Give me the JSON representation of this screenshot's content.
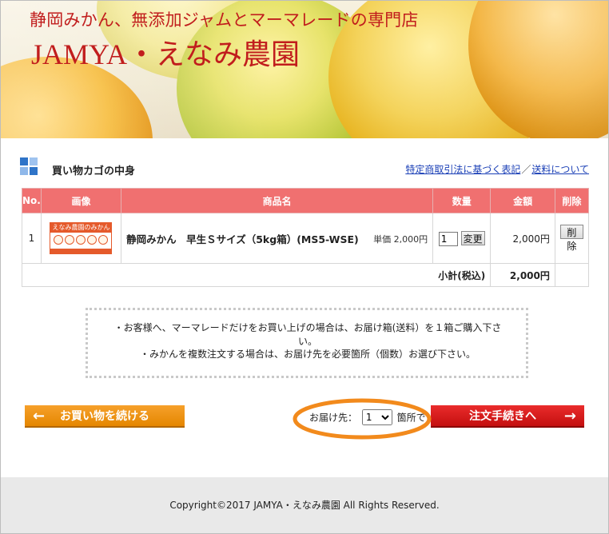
{
  "header": {
    "tagline": "静岡みかん、無添加ジャムとマーマレードの専門店",
    "title": "JAMYA・えなみ農園"
  },
  "section": {
    "title": "買い物カゴの中身",
    "links": [
      "特定商取引法に基づく表記",
      "送料について"
    ],
    "link_separator": "／"
  },
  "table": {
    "headers": [
      "No.",
      "画像",
      "商品名",
      "数量",
      "金額",
      "削除"
    ],
    "rows": [
      {
        "no": "1",
        "image_text": "えなみ農園のみかん",
        "name": "静岡みかん　早生Ｓサイズ（5kg箱）(MS5-WSE)",
        "unit_price": "単価 2,000円",
        "quantity": "1",
        "change_label": "変更",
        "amount": "2,000円",
        "delete_label": "削除"
      }
    ],
    "subtotal_label": "小計(税込)",
    "subtotal_value": "2,000円"
  },
  "notice": {
    "line1": "・お客様へ、マーマレードだけをお買い上げの場合は、お届け箱(送料）を１箱ご購入下さい。",
    "line2": "・みかんを複数注文する場合は、お届け先を必要箇所（個数）お選び下さい。"
  },
  "actions": {
    "continue_label": "お買い物を続ける",
    "continue_arrow": "←",
    "destination_prefix": "お届け先：",
    "destination_value": "1",
    "destination_suffix": "箇所で",
    "order_label": "注文手続きへ",
    "order_arrow": "→"
  },
  "footer": {
    "copyright": "Copyright©2017 JAMYA・えなみ農園 All Rights Reserved."
  },
  "colors": {
    "brand_red": "#c11d1d",
    "table_header": "#f07070",
    "continue_button": "#e58700",
    "order_button": "#d01818",
    "annotation": "#f28a1c"
  }
}
